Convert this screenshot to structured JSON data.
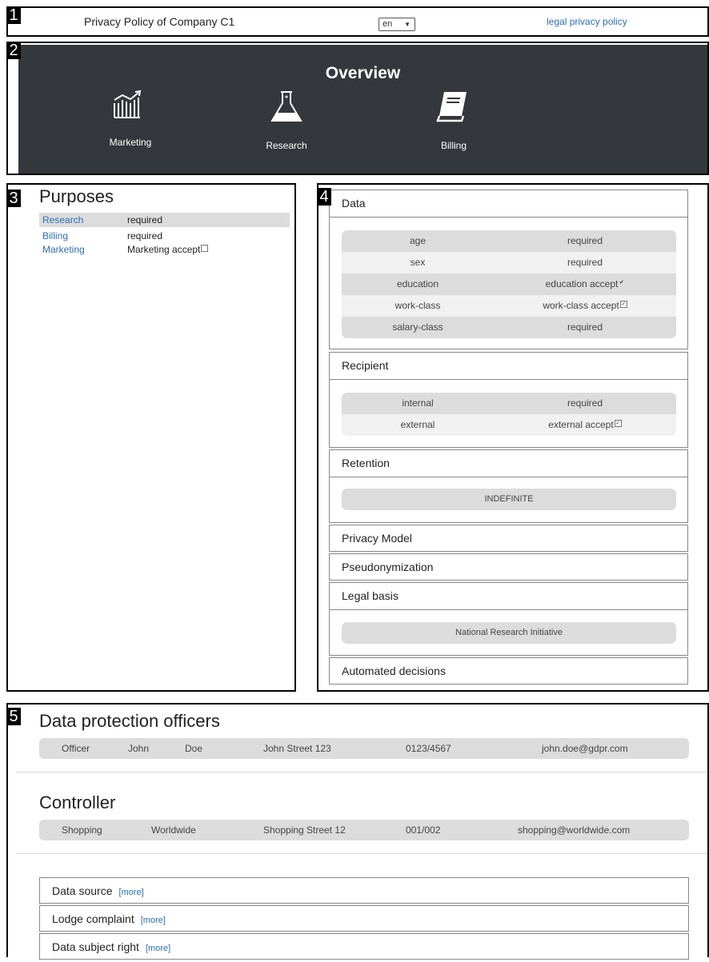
{
  "section_tags": [
    "1",
    "2",
    "3",
    "4",
    "5"
  ],
  "topbar": {
    "title": "Privacy Policy of Company C1",
    "language": "en",
    "legal_link": "legal privacy policy"
  },
  "overview": {
    "heading": "Overview",
    "items": [
      {
        "label": "Marketing",
        "icon": "chart-trend-icon"
      },
      {
        "label": "Research",
        "icon": "flask-icon"
      },
      {
        "label": "Billing",
        "icon": "book-icon"
      }
    ]
  },
  "purposes": {
    "heading": "Purposes",
    "rows": [
      {
        "name": "Research",
        "value": "required"
      },
      {
        "name": "Billing",
        "value": "required"
      },
      {
        "name": "Marketing",
        "value": "Marketing accept",
        "checkbox": false
      }
    ]
  },
  "details": {
    "data": {
      "title": "Data",
      "rows": [
        {
          "key": "age",
          "value": "required"
        },
        {
          "key": "sex",
          "value": "required"
        },
        {
          "key": "education",
          "value": "education accept",
          "checkbox": true
        },
        {
          "key": "work-class",
          "value": "work-class accept",
          "checkbox": true
        },
        {
          "key": "salary-class",
          "value": "required"
        }
      ]
    },
    "recipient": {
      "title": "Recipient",
      "rows": [
        {
          "key": "internal",
          "value": "required"
        },
        {
          "key": "external",
          "value": "external accept",
          "checkbox": true
        }
      ]
    },
    "retention": {
      "title": "Retention",
      "value": "INDEFINITE"
    },
    "privacy_model": {
      "title": "Privacy Model"
    },
    "pseudonymization": {
      "title": "Pseudonymization"
    },
    "legal_basis": {
      "title": "Legal basis",
      "value": "National Research Initiative"
    },
    "automated_decisions": {
      "title": "Automated decisions"
    }
  },
  "dpo": {
    "heading": "Data protection officers",
    "fields": [
      "Officer",
      "John",
      "Doe",
      "John Street 123",
      "0123/4567",
      "john.doe@gdpr.com"
    ]
  },
  "controller": {
    "heading": "Controller",
    "fields": [
      "Shopping",
      "Worldwide",
      "Shopping Street 12",
      "001/002",
      "shopping@worldwide.com"
    ]
  },
  "more_sections": [
    {
      "label": "Data source",
      "link": "[more]"
    },
    {
      "label": "Lodge complaint",
      "link": "[more]"
    },
    {
      "label": "Data subject right",
      "link": "[more]"
    }
  ],
  "colors": {
    "banner": "#34383c",
    "link": "#2a6fb6",
    "row_dark": "#dcdcdc",
    "row_light": "#f1f1f1"
  }
}
